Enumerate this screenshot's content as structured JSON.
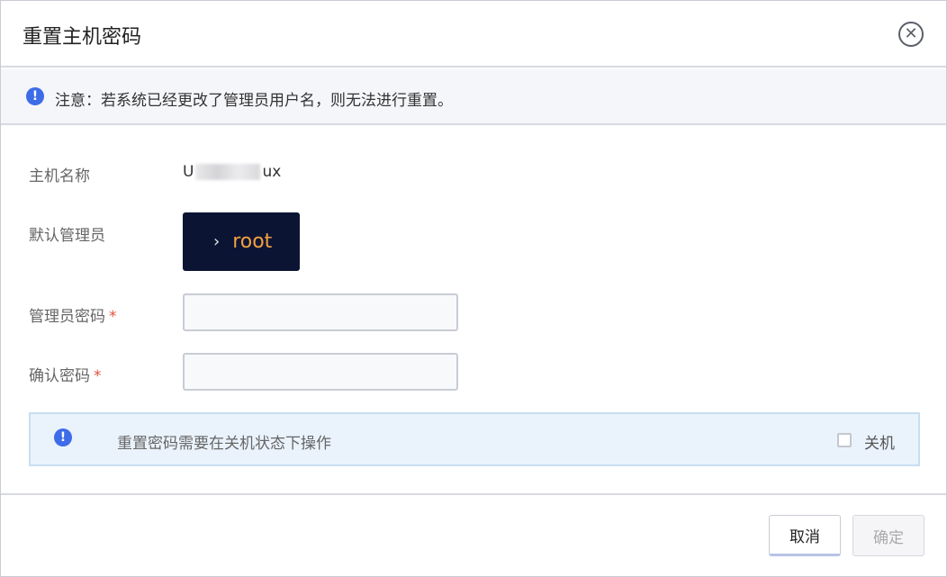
{
  "dialog": {
    "title": "重置主机密码",
    "close_icon": "close-circle-icon"
  },
  "notice": {
    "icon": "info-icon",
    "icon_glyph": "!",
    "text": "注意：若系统已经更改了管理员用户名，则无法进行重置。"
  },
  "form": {
    "hostname_label": "主机名称",
    "hostname_prefix": "U",
    "hostname_suffix": "ux",
    "default_admin_label": "默认管理员",
    "terminal_prompt": "›",
    "admin_user": "root",
    "password_label": "管理员密码",
    "confirm_label": "确认密码",
    "required_mark": "*",
    "password_value": "",
    "confirm_value": ""
  },
  "warning": {
    "icon": "info-icon",
    "icon_glyph": "!",
    "text": "重置密码需要在关机状态下操作",
    "checkbox_label": "关机",
    "checkbox_checked": false
  },
  "footer": {
    "cancel_label": "取消",
    "ok_label": "确定"
  },
  "colors": {
    "accent": "#3e6be8",
    "terminal_bg": "#0b1533",
    "terminal_text": "#f5a042",
    "required": "#e0533d",
    "warning_bg": "#eaf3fc"
  }
}
